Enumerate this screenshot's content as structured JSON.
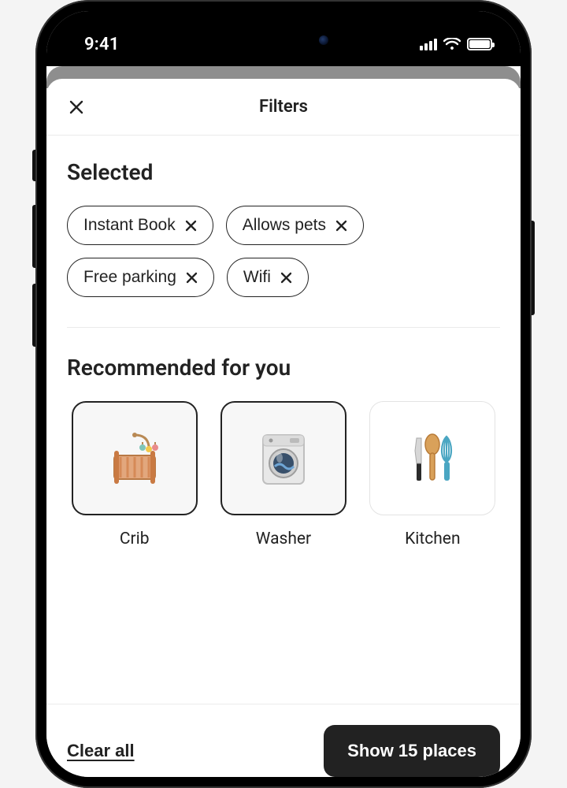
{
  "status": {
    "time": "9:41"
  },
  "header": {
    "title": "Filters"
  },
  "selected": {
    "title": "Selected",
    "chips": [
      {
        "label": "Instant Book"
      },
      {
        "label": "Allows pets"
      },
      {
        "label": "Free parking"
      },
      {
        "label": "Wifi"
      }
    ]
  },
  "recommended": {
    "title": "Recommended for you",
    "cards": [
      {
        "label": "Crib",
        "icon": "crib-icon",
        "selected": true
      },
      {
        "label": "Washer",
        "icon": "washer-icon",
        "selected": true
      },
      {
        "label": "Kitchen",
        "icon": "kitchen-icon",
        "selected": false
      }
    ]
  },
  "footer": {
    "clear_label": "Clear all",
    "show_label": "Show 15 places"
  }
}
